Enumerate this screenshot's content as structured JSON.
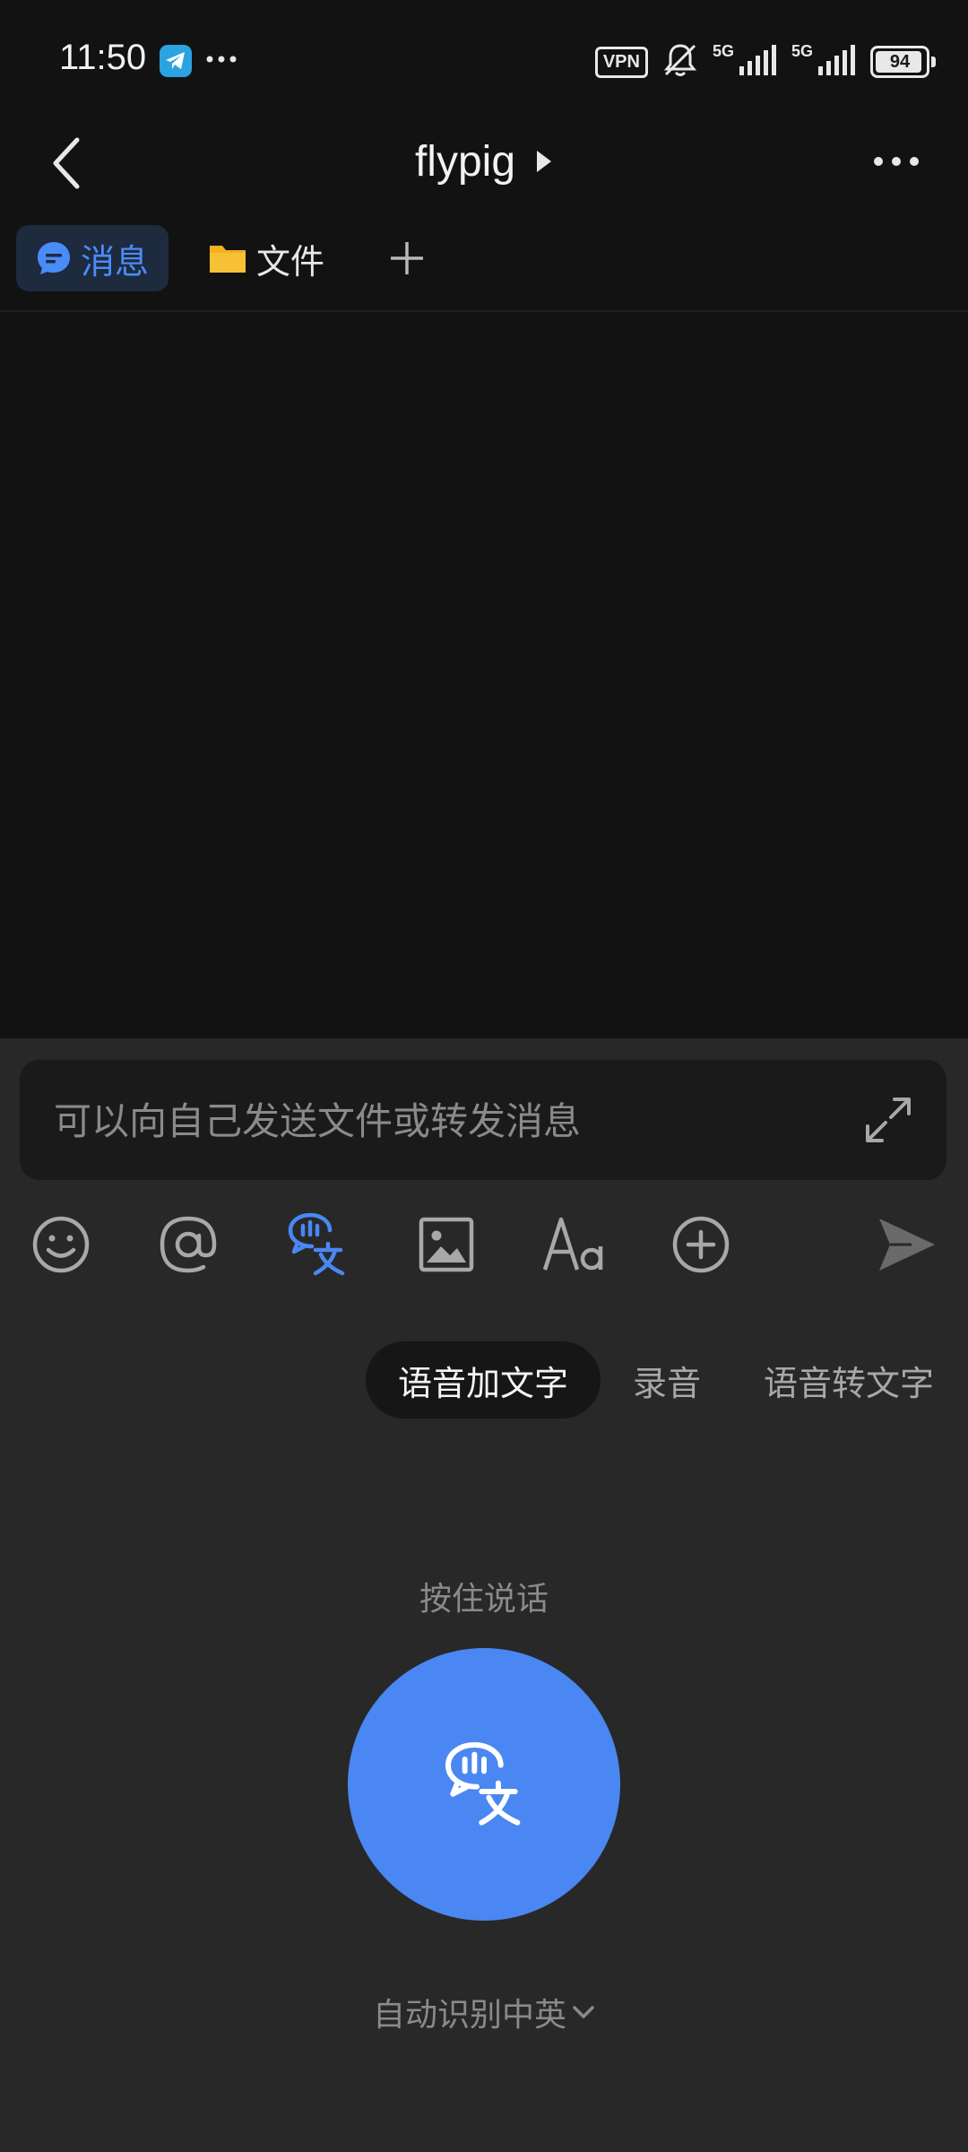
{
  "status_bar": {
    "time": "11:50",
    "vpn": "VPN",
    "net1": "5G",
    "net2": "5G",
    "battery": "94",
    "battery_level": 0.94
  },
  "header": {
    "title": "flypig"
  },
  "tabs": [
    {
      "label": "消息",
      "active": true
    },
    {
      "label": "文件",
      "active": false
    }
  ],
  "input": {
    "placeholder": "可以向自己发送文件或转发消息",
    "value": ""
  },
  "modes": [
    {
      "label": "语音加文字",
      "active": true
    },
    {
      "label": "录音",
      "active": false
    },
    {
      "label": "语音转文字",
      "active": false
    }
  ],
  "voice": {
    "hold_label": "按住说话",
    "language": "自动识别中英"
  },
  "colors": {
    "accent": "#4a87f2",
    "background": "#121212",
    "panel": "#282828"
  }
}
